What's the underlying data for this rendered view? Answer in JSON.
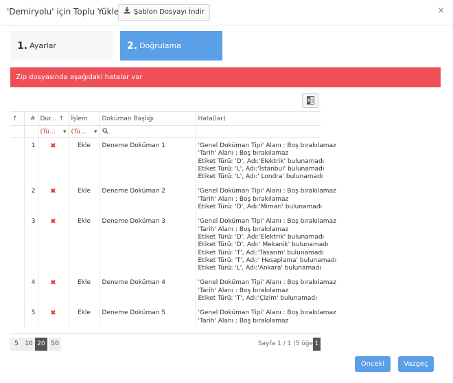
{
  "header": {
    "title": "'Demiryolu' için Toplu Yükleme",
    "template_button": "Şablon Dosyayı İndir",
    "close": "×"
  },
  "steps": [
    {
      "num": "1.",
      "label": "Ayarlar"
    },
    {
      "num": "2.",
      "label": "Doğrulama"
    }
  ],
  "alert": "Zip dosyasında aşağıdaki hatalar var",
  "grid": {
    "columns": {
      "sort": "↑",
      "num": "#",
      "status": "Dur...",
      "status_sort": "↑",
      "action": "İşlem",
      "title": "Doküman Başlığı",
      "errors": "Hata(lar)"
    },
    "filters": {
      "status": "(Tü...",
      "action": "(Tü..."
    },
    "rows": [
      {
        "num": "1",
        "status": "✖",
        "action": "Ekle",
        "title": "Deneme Doküman 1",
        "errors": [
          "'Genel Doküman Tipi' Alanı : Boş bırakılamaz",
          "'Tarih' Alanı : Boş bırakılamaz",
          "Etiket Türü: 'D', Adı:'Elektrik' bulunamadı",
          "Etiket Türü: 'L', Adı:'İstanbul' bulunamadı",
          "Etiket Türü: 'L', Adı:' Londra' bulunamadı"
        ]
      },
      {
        "num": "2",
        "status": "✖",
        "action": "Ekle",
        "title": "Deneme Doküman 2",
        "errors": [
          "'Genel Doküman Tipi' Alanı : Boş bırakılamaz",
          "'Tarih' Alanı : Boş bırakılamaz",
          "Etiket Türü: 'D', Adı:'Mimari' bulunamadı"
        ]
      },
      {
        "num": "3",
        "status": "✖",
        "action": "Ekle",
        "title": "Deneme Doküman 3",
        "errors": [
          "'Genel Doküman Tipi' Alanı : Boş bırakılamaz",
          "'Tarih' Alanı : Boş bırakılamaz",
          "Etiket Türü: 'D', Adı:'Elektrik' bulunamadı",
          "Etiket Türü: 'D', Adı:' Mekanik' bulunamadı",
          "Etiket Türü: 'T', Adı:'Tasarım' bulunamadı",
          "Etiket Türü: 'T', Adı:' Hesaplama' bulunamadı",
          "Etiket Türü: 'L', Adı:'Ankara' bulunamadı"
        ]
      },
      {
        "num": "4",
        "status": "✖",
        "action": "Ekle",
        "title": "Deneme Doküman 4",
        "errors": [
          "'Genel Doküman Tipi' Alanı : Boş bırakılamaz",
          "'Tarih' Alanı : Boş bırakılamaz",
          "Etiket Türü: 'T', Adı:'Çizim' bulunamadı"
        ]
      },
      {
        "num": "5",
        "status": "✖",
        "action": "Ekle",
        "title": "Deneme Doküman 5",
        "errors": [
          "'Genel Doküman Tipi' Alanı : Boş bırakılamaz",
          "'Tarih' Alanı : Boş bırakılamaz"
        ]
      }
    ]
  },
  "pager": {
    "sizes": [
      "5",
      "10",
      "20",
      "50"
    ],
    "active_size": "20",
    "info": "Sayfa 1 / 1 (5 öğe)",
    "current_page": "1"
  },
  "footer": {
    "prev": "Önceki",
    "cancel": "Vazgeç"
  },
  "colors": {
    "accent": "#5b9fe8",
    "error": "#ef5057"
  }
}
